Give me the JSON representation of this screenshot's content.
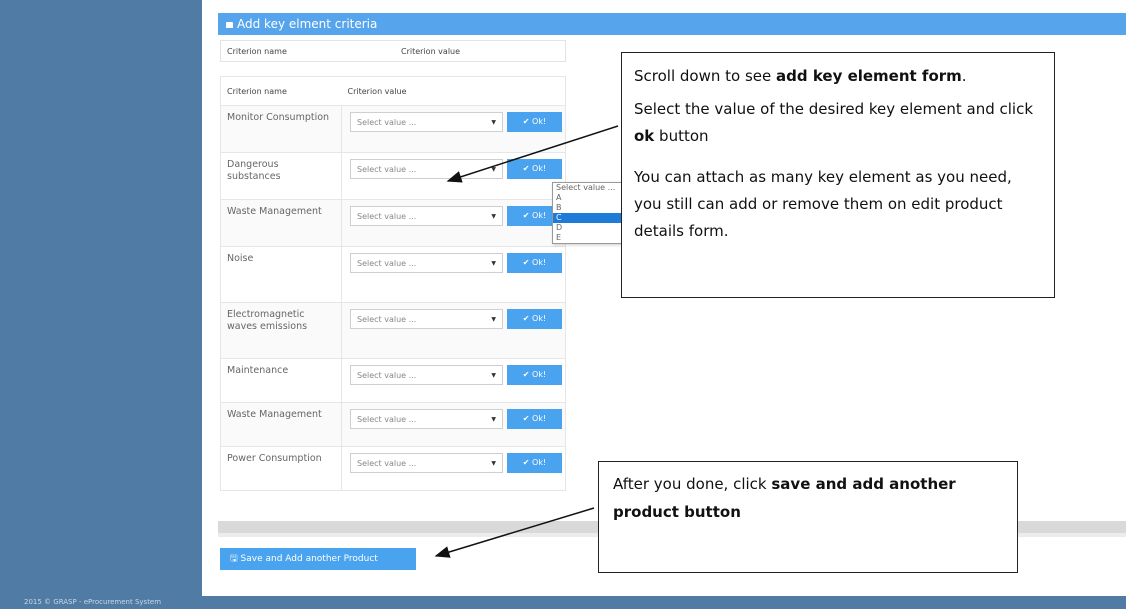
{
  "panel": {
    "title": "Add key elment criteria"
  },
  "top_header": {
    "col1": "Criterion name",
    "col2": "Criterion value"
  },
  "table": {
    "col1": "Criterion name",
    "col2": "Criterion value",
    "placeholder": "Select value ...",
    "ok_label": "Ok!",
    "rows": [
      {
        "name": "Monitor Consumption"
      },
      {
        "name": "Dangerous substances"
      },
      {
        "name": "Waste Management"
      },
      {
        "name": "Noise"
      },
      {
        "name": "Electromagnetic waves emissions"
      },
      {
        "name": "Maintenance"
      },
      {
        "name": "Waste Management"
      },
      {
        "name": "Power Consumption"
      }
    ]
  },
  "dropdown": {
    "options": [
      "Select value ...",
      "A",
      "B",
      "C",
      "D",
      "E"
    ],
    "selected": "C"
  },
  "save_button": {
    "label": "Save and Add another Product"
  },
  "footer": {
    "text": "2015 © GRASP - eProcurement System"
  },
  "callout1": {
    "p1_pre": "Scroll down to see ",
    "p1_bold": "add key element form",
    "p1_post": ".",
    "p2_pre": "Select the value of the desired key element and click ",
    "p2_bold": "ok",
    "p2_post": " button",
    "p3": "You can attach as many key element as you need, you still can add or remove them on edit product details form."
  },
  "callout2": {
    "pre": "After you done, click ",
    "bold": "save and add another product button"
  },
  "colors": {
    "sidebar": "#4f7ba4",
    "accent": "#55a4ec",
    "button": "#4aa3ef",
    "selected_option": "#1e7bd8"
  }
}
